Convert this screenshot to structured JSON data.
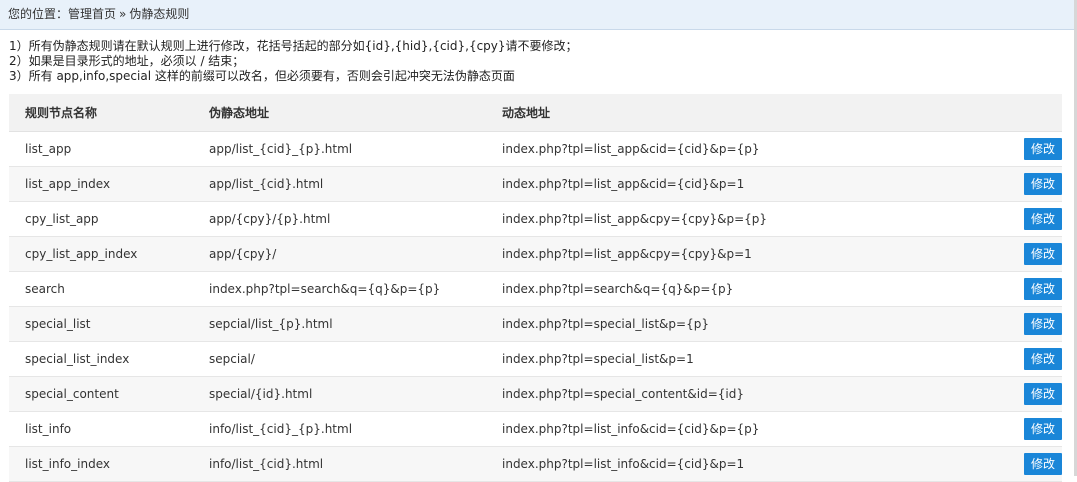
{
  "breadcrumb": {
    "prefix": "您的位置：",
    "home": "管理首页",
    "separator": "»",
    "current": "伪静态规则"
  },
  "notes": [
    "1）所有伪静态规则请在默认规则上进行修改，花括号括起的部分如{id},{hid},{cid},{cpy}请不要修改；",
    "2）如果是目录形式的地址，必须以 / 结束；",
    "3）所有 app,info,special 这样的前缀可以改名，但必须要有，否则会引起冲突无法伪静态页面"
  ],
  "table": {
    "headers": [
      "规则节点名称",
      "伪静态地址",
      "动态地址"
    ],
    "edit_label": "修改",
    "rows": [
      {
        "name": "list_app",
        "rewrite": "app/list_{cid}_{p}.html",
        "dynamic": "index.php?tpl=list_app&cid={cid}&p={p}"
      },
      {
        "name": "list_app_index",
        "rewrite": "app/list_{cid}.html",
        "dynamic": "index.php?tpl=list_app&cid={cid}&p=1"
      },
      {
        "name": "cpy_list_app",
        "rewrite": "app/{cpy}/{p}.html",
        "dynamic": "index.php?tpl=list_app&cpy={cpy}&p={p}"
      },
      {
        "name": "cpy_list_app_index",
        "rewrite": "app/{cpy}/",
        "dynamic": "index.php?tpl=list_app&cpy={cpy}&p=1"
      },
      {
        "name": "search",
        "rewrite": "index.php?tpl=search&q={q}&p={p}",
        "dynamic": "index.php?tpl=search&q={q}&p={p}"
      },
      {
        "name": "special_list",
        "rewrite": "sepcial/list_{p}.html",
        "dynamic": "index.php?tpl=special_list&p={p}"
      },
      {
        "name": "special_list_index",
        "rewrite": "sepcial/",
        "dynamic": "index.php?tpl=special_list&p=1"
      },
      {
        "name": "special_content",
        "rewrite": "special/{id}.html",
        "dynamic": "index.php?tpl=special_content&id={id}"
      },
      {
        "name": "list_info",
        "rewrite": "info/list_{cid}_{p}.html",
        "dynamic": "index.php?tpl=list_info&cid={cid}&p={p}"
      },
      {
        "name": "list_info_index",
        "rewrite": "info/list_{cid}.html",
        "dynamic": "index.php?tpl=list_info&cid={cid}&p=1"
      }
    ]
  },
  "colors": {
    "breadcrumb_bg": "#e8f1fa",
    "button_bg": "#1a86d8",
    "header_bg": "#f2f2f2",
    "alt_row_bg": "#f7f7f7"
  }
}
